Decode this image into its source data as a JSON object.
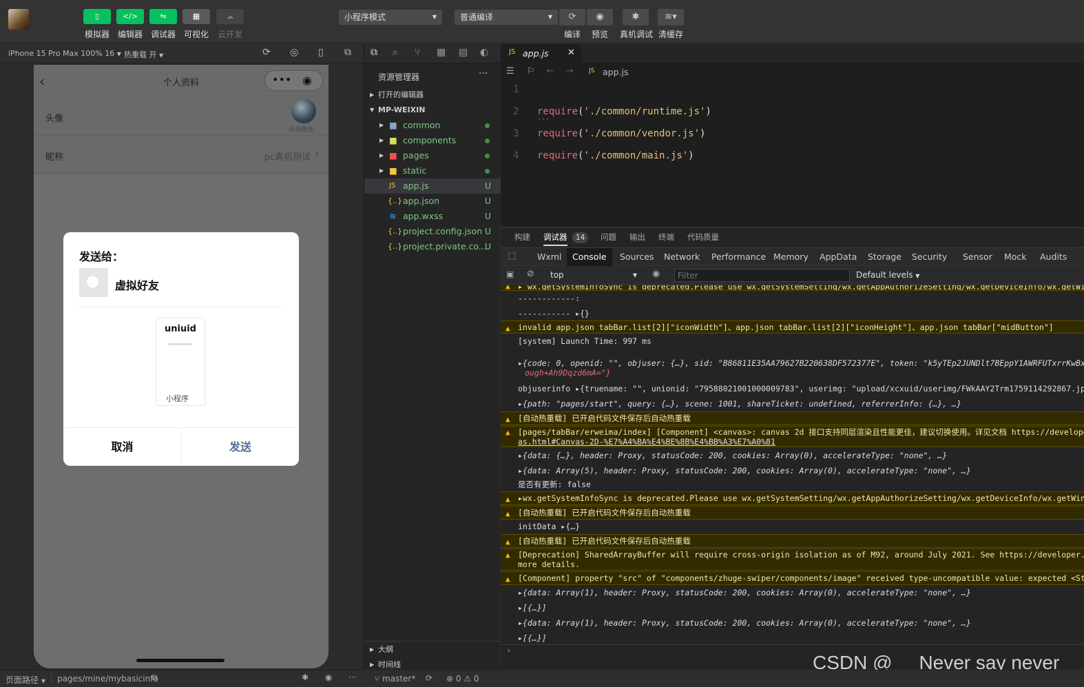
{
  "toolbar": {
    "buttons": [
      {
        "label": "模拟器",
        "icon": "phone-icon"
      },
      {
        "label": "编辑器",
        "icon": "code-icon"
      },
      {
        "label": "调试器",
        "icon": "debug-icon"
      },
      {
        "label": "可视化",
        "icon": "layout-icon"
      },
      {
        "label": "云开发",
        "icon": "cloud-icon"
      }
    ],
    "mode_select": "小程序模式",
    "compile_select": "普通编译",
    "right_buttons": [
      {
        "label": "编译",
        "icon": "refresh-icon"
      },
      {
        "label": "预览",
        "icon": "eye-icon"
      },
      {
        "label": "真机调试",
        "icon": "bug-icon"
      },
      {
        "label": "清缓存",
        "icon": "layers-icon"
      }
    ]
  },
  "simulator": {
    "device": "iPhone 15 Pro Max 100% 16",
    "hot_reload": "热重载 开",
    "page_title": "个人资料",
    "rows": [
      {
        "label": "头像",
        "value": "点击修改"
      },
      {
        "label": "昵称",
        "value": "pc真机测试"
      }
    ],
    "dialog": {
      "title": "发送给：",
      "friend": "虚拟好友",
      "card_title": "uniuid",
      "card_footer": "小程序",
      "cancel": "取消",
      "send": "发送"
    }
  },
  "explorer": {
    "title": "资源管理器",
    "open_editors": "打开的编辑器",
    "project": "MP-WEIXIN",
    "items": [
      {
        "name": "common",
        "type": "folder",
        "status": "dot"
      },
      {
        "name": "components",
        "type": "folder",
        "status": "dot"
      },
      {
        "name": "pages",
        "type": "folder",
        "status": "dot"
      },
      {
        "name": "static",
        "type": "folder",
        "status": "dot"
      },
      {
        "name": "app.js",
        "type": "js",
        "status": "U"
      },
      {
        "name": "app.json",
        "type": "json",
        "status": "U"
      },
      {
        "name": "app.wxss",
        "type": "wxss",
        "status": "U"
      },
      {
        "name": "project.config.json",
        "type": "json",
        "status": "U"
      },
      {
        "name": "project.private.co...",
        "type": "json",
        "status": "U"
      }
    ],
    "outline": "大纲",
    "timeline": "时间线"
  },
  "editor": {
    "tab": "app.js",
    "breadcrumb": "app.js",
    "lines": [
      {
        "n": "1",
        "fn": "",
        "arg": ""
      },
      {
        "n": "2",
        "fn": "require",
        "arg": "'./common/runtime.js'"
      },
      {
        "n": "3",
        "fn": "require",
        "arg": "'./common/vendor.js'"
      },
      {
        "n": "4",
        "fn": "require",
        "arg": "'./common/main.js'"
      }
    ]
  },
  "devtools": {
    "panel_tabs": [
      "构建",
      "调试器",
      "问题",
      "输出",
      "终端",
      "代码质量"
    ],
    "badge": "14",
    "tabs": [
      "Wxml",
      "Console",
      "Sources",
      "Network",
      "Performance",
      "Memory",
      "AppData",
      "Storage",
      "Security",
      "Sensor",
      "Mock",
      "Audits"
    ],
    "context": "top",
    "filter_placeholder": "Filter",
    "levels": "Default levels",
    "logs": [
      {
        "t": "warn",
        "text": "▸ wx.getSystemInfoSync is deprecated.Please use wx.getSystemSetting/wx.getAppAuthorizeSetting/wx.getDeviceInfo/wx.getWindowInfo"
      },
      {
        "t": "info",
        "text": "------------:"
      },
      {
        "t": "info",
        "text": "----------- ▸{}"
      },
      {
        "t": "warn",
        "text": "invalid app.json tabBar.list[2][\"iconWidth\"]、app.json tabBar.list[2][\"iconHeight\"]、app.json tabBar[\"midButton\"]"
      },
      {
        "t": "info",
        "text": "[system] Launch Time: 997 ms"
      },
      {
        "t": "info",
        "text": "▸{code: 0, openid: \"\", objuser: {…}, sid: \"B86811E35AA79627B220638DF572377E\", token: \"k5yTEp2JUNDlt7BEppY1AWRFUTxrrKwBxh4iB",
        "text2": "ough+Ah9Dqzd6mA=\"}"
      },
      {
        "t": "info",
        "text": "objuserinfo ▸{truename: \"\", unionid: \"79588021001000009783\", userimg: \"upload/xcxuid/userimg/FWkAAY2Trm1759114292867.jpeg\","
      },
      {
        "t": "info",
        "text": "▸{path: \"pages/start\", query: {…}, scene: 1001, shareTicket: undefined, referrerInfo: {…}, …}"
      },
      {
        "t": "warn",
        "text": "[自动热重载] 已开启代码文件保存后自动热重载"
      },
      {
        "t": "warn",
        "text": "[pages/tabBar/erweima/index] [Component] <canvas>: canvas 2d 接口支持同层渲染且性能更佳，建议切换使用。详见文档 https://developer",
        "text2": "as.html#Canvas-2D-%E7%A4%BA%E4%BE%8B%E4%BB%A3%E7%A0%81"
      },
      {
        "t": "info",
        "text": "▸{data: {…}, header: Proxy, statusCode: 200, cookies: Array(0), accelerateType: \"none\", …}"
      },
      {
        "t": "info",
        "text": "▸{data: Array(5), header: Proxy, statusCode: 200, cookies: Array(0), accelerateType: \"none\", …}"
      },
      {
        "t": "info",
        "text": "是否有更新: false"
      },
      {
        "t": "warn",
        "text": "▸wx.getSystemInfoSync is deprecated.Please use wx.getSystemSetting/wx.getAppAuthorizeSetting/wx.getDeviceInfo/wx.getWindowInf"
      },
      {
        "t": "warn",
        "text": "[自动热重载] 已开启代码文件保存后自动热重载"
      },
      {
        "t": "info",
        "text": "initData ▸{…}"
      },
      {
        "t": "warn",
        "text": "[自动热重载] 已开启代码文件保存后自动热重载"
      },
      {
        "t": "warn",
        "text": "[Deprecation] SharedArrayBuffer will require cross-origin isolation as of M92, around July 2021. See https://developer.chrom",
        "text2": "more details."
      },
      {
        "t": "warn",
        "text": "[Component] property \"src\" of \"components/zhuge-swiper/components/image\" received type-uncompatible value: expected <String>"
      },
      {
        "t": "info",
        "text": "▸{data: Array(1), header: Proxy, statusCode: 200, cookies: Array(0), accelerateType: \"none\", …}"
      },
      {
        "t": "info",
        "text": "▸[{…}]"
      },
      {
        "t": "info",
        "text": "▸{data: Array(1), header: Proxy, statusCode: 200, cookies: Array(0), accelerateType: \"none\", …}"
      },
      {
        "t": "info",
        "text": "▸[{…}]"
      }
    ]
  },
  "statusbar": {
    "path_label": "页面路径",
    "path": "pages/mine/mybasicinfo",
    "branch": "master*",
    "counts": "⊗ 0 ⚠ 0"
  },
  "watermark": "CSDN @     Never say never"
}
